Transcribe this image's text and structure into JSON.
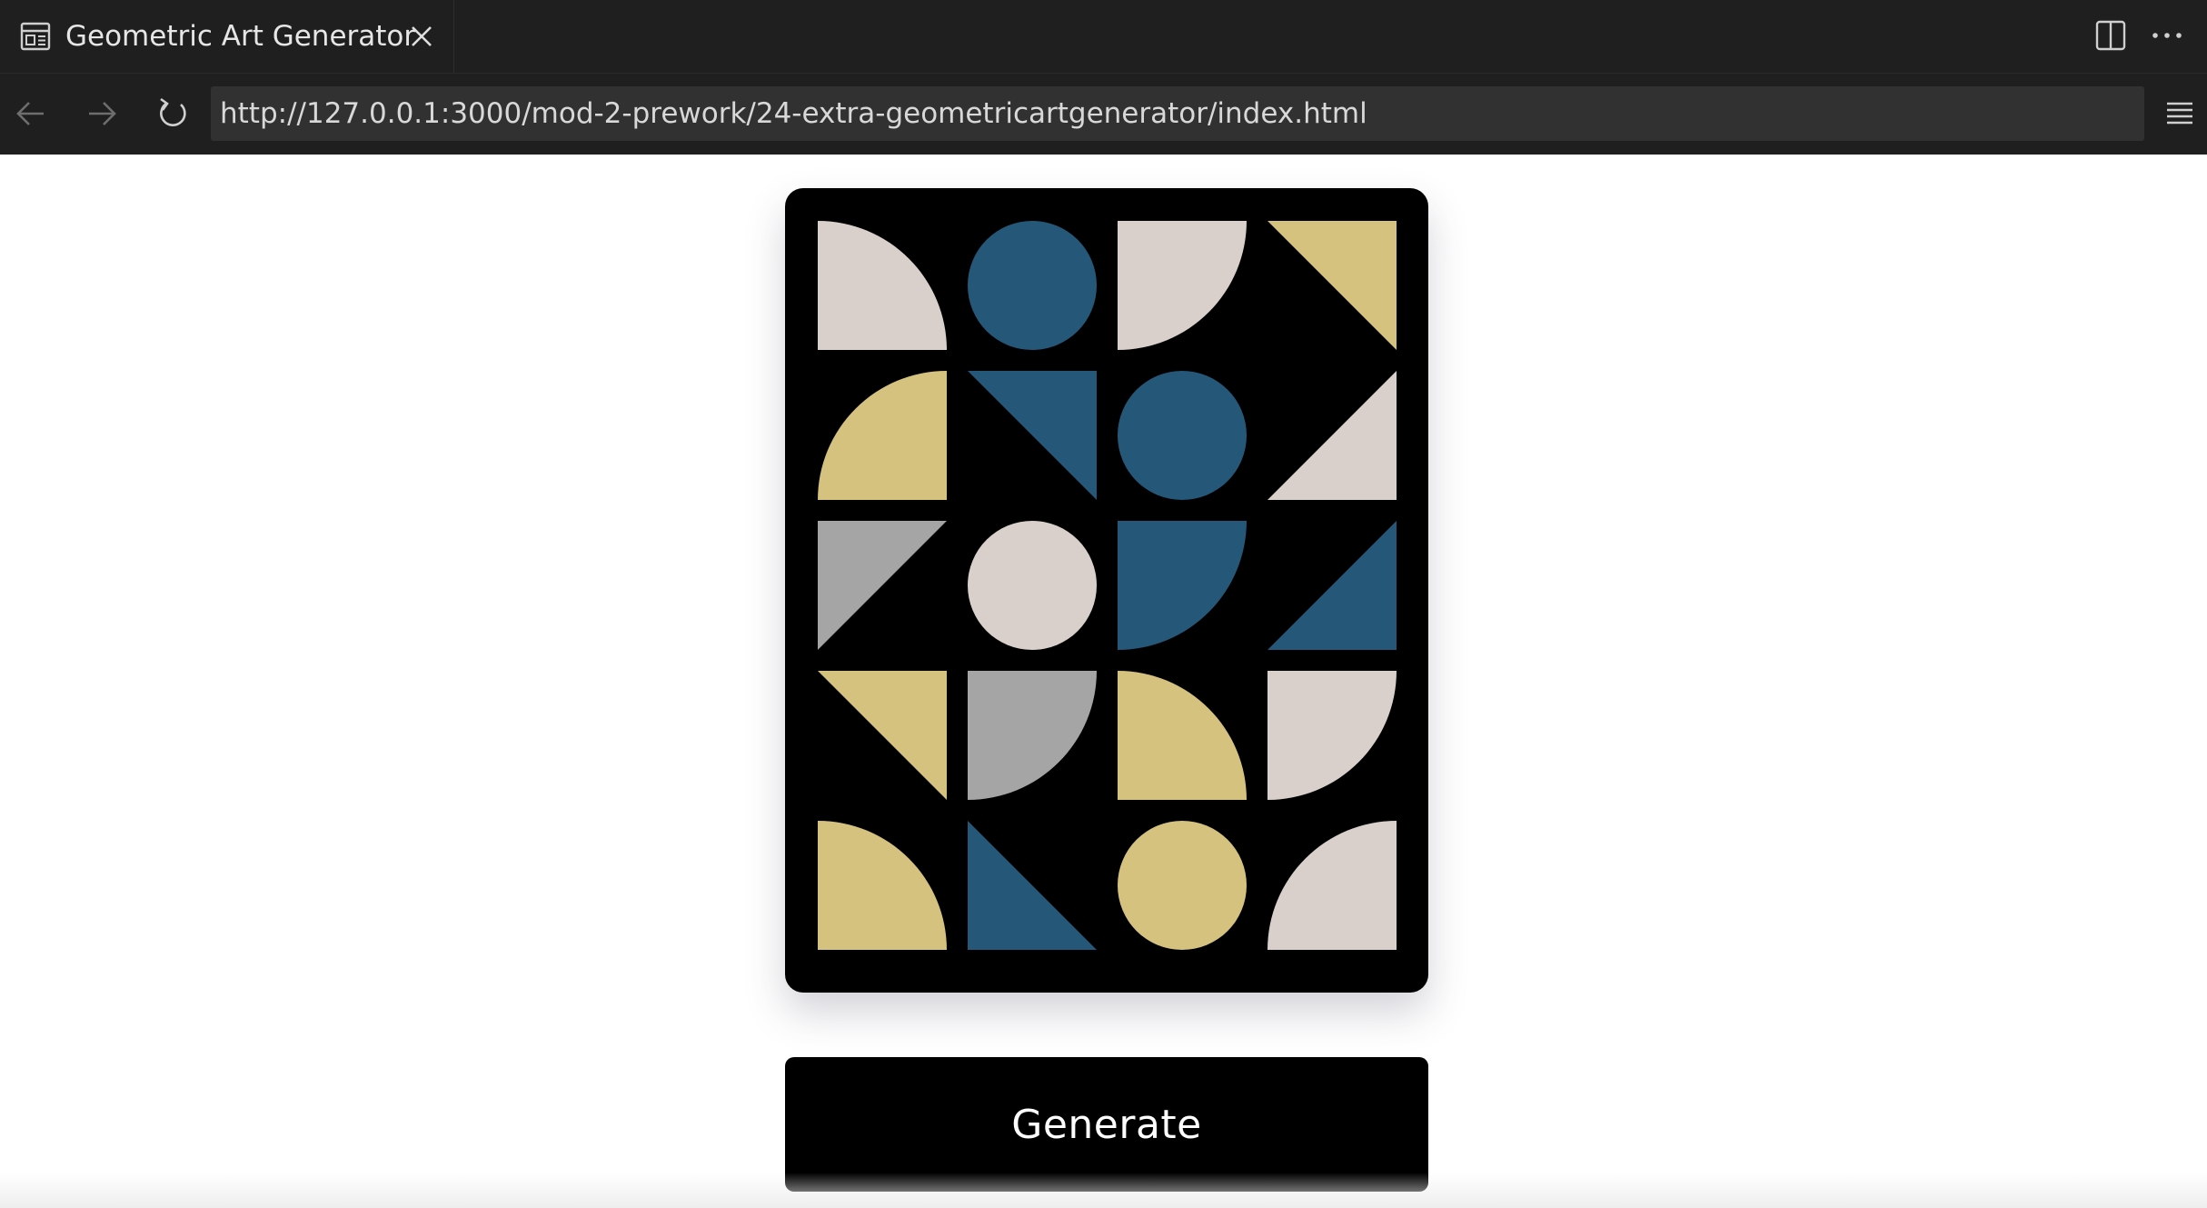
{
  "browser": {
    "tab": {
      "title": "Geometric Art Generator",
      "icon": "preview-icon"
    },
    "url": "http://127.0.0.1:3000/mod-2-prework/24-extra-geometricartgenerator/index.html",
    "icons": [
      "back-arrow-icon",
      "forward-arrow-icon",
      "reload-icon",
      "split-editor-icon",
      "more-icon",
      "menu-icon",
      "close-icon"
    ]
  },
  "art": {
    "colors": {
      "background": "#000000",
      "cream": "#d9d0cc",
      "blue": "#255878",
      "gold": "#d6c27f",
      "gray": "#a5a5a5"
    },
    "columns": 4,
    "rows": 5,
    "tiles": [
      {
        "shape": "quarter-circle",
        "corner": "bl",
        "color": "cream"
      },
      {
        "shape": "circle",
        "color": "blue"
      },
      {
        "shape": "quarter-circle",
        "corner": "tl",
        "color": "cream"
      },
      {
        "shape": "triangle",
        "corner": "tr",
        "color": "gold"
      },
      {
        "shape": "quarter-circle",
        "corner": "br",
        "color": "gold"
      },
      {
        "shape": "triangle",
        "corner": "tr",
        "color": "blue"
      },
      {
        "shape": "circle",
        "color": "blue"
      },
      {
        "shape": "triangle",
        "corner": "br",
        "color": "cream"
      },
      {
        "shape": "triangle",
        "corner": "tl",
        "color": "gray"
      },
      {
        "shape": "circle",
        "color": "cream"
      },
      {
        "shape": "quarter-circle",
        "corner": "tl",
        "color": "blue"
      },
      {
        "shape": "triangle",
        "corner": "br",
        "color": "blue"
      },
      {
        "shape": "triangle",
        "corner": "tr",
        "color": "gold"
      },
      {
        "shape": "quarter-circle",
        "corner": "tl",
        "color": "gray"
      },
      {
        "shape": "quarter-circle",
        "corner": "bl",
        "color": "gold"
      },
      {
        "shape": "quarter-circle",
        "corner": "tl",
        "color": "cream"
      },
      {
        "shape": "quarter-circle",
        "corner": "bl",
        "color": "gold"
      },
      {
        "shape": "triangle",
        "corner": "bl",
        "color": "blue"
      },
      {
        "shape": "circle",
        "color": "gold"
      },
      {
        "shape": "quarter-circle",
        "corner": "br",
        "color": "cream"
      }
    ]
  },
  "generate_label": "Generate"
}
